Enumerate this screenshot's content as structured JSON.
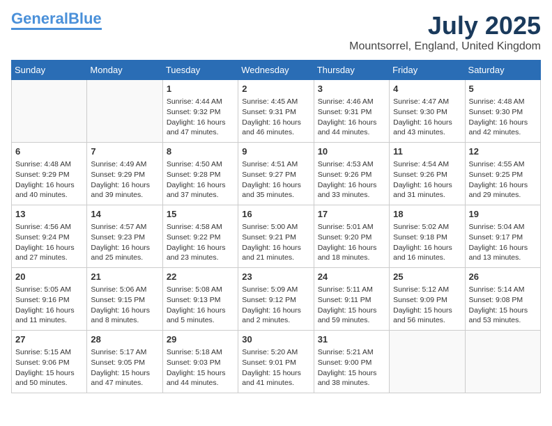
{
  "header": {
    "logo_general": "General",
    "logo_blue": "Blue",
    "month_year": "July 2025",
    "location": "Mountsorrel, England, United Kingdom"
  },
  "days_of_week": [
    "Sunday",
    "Monday",
    "Tuesday",
    "Wednesday",
    "Thursday",
    "Friday",
    "Saturday"
  ],
  "weeks": [
    [
      {
        "day": "",
        "info": ""
      },
      {
        "day": "",
        "info": ""
      },
      {
        "day": "1",
        "info": "Sunrise: 4:44 AM\nSunset: 9:32 PM\nDaylight: 16 hours\nand 47 minutes."
      },
      {
        "day": "2",
        "info": "Sunrise: 4:45 AM\nSunset: 9:31 PM\nDaylight: 16 hours\nand 46 minutes."
      },
      {
        "day": "3",
        "info": "Sunrise: 4:46 AM\nSunset: 9:31 PM\nDaylight: 16 hours\nand 44 minutes."
      },
      {
        "day": "4",
        "info": "Sunrise: 4:47 AM\nSunset: 9:30 PM\nDaylight: 16 hours\nand 43 minutes."
      },
      {
        "day": "5",
        "info": "Sunrise: 4:48 AM\nSunset: 9:30 PM\nDaylight: 16 hours\nand 42 minutes."
      }
    ],
    [
      {
        "day": "6",
        "info": "Sunrise: 4:48 AM\nSunset: 9:29 PM\nDaylight: 16 hours\nand 40 minutes."
      },
      {
        "day": "7",
        "info": "Sunrise: 4:49 AM\nSunset: 9:29 PM\nDaylight: 16 hours\nand 39 minutes."
      },
      {
        "day": "8",
        "info": "Sunrise: 4:50 AM\nSunset: 9:28 PM\nDaylight: 16 hours\nand 37 minutes."
      },
      {
        "day": "9",
        "info": "Sunrise: 4:51 AM\nSunset: 9:27 PM\nDaylight: 16 hours\nand 35 minutes."
      },
      {
        "day": "10",
        "info": "Sunrise: 4:53 AM\nSunset: 9:26 PM\nDaylight: 16 hours\nand 33 minutes."
      },
      {
        "day": "11",
        "info": "Sunrise: 4:54 AM\nSunset: 9:26 PM\nDaylight: 16 hours\nand 31 minutes."
      },
      {
        "day": "12",
        "info": "Sunrise: 4:55 AM\nSunset: 9:25 PM\nDaylight: 16 hours\nand 29 minutes."
      }
    ],
    [
      {
        "day": "13",
        "info": "Sunrise: 4:56 AM\nSunset: 9:24 PM\nDaylight: 16 hours\nand 27 minutes."
      },
      {
        "day": "14",
        "info": "Sunrise: 4:57 AM\nSunset: 9:23 PM\nDaylight: 16 hours\nand 25 minutes."
      },
      {
        "day": "15",
        "info": "Sunrise: 4:58 AM\nSunset: 9:22 PM\nDaylight: 16 hours\nand 23 minutes."
      },
      {
        "day": "16",
        "info": "Sunrise: 5:00 AM\nSunset: 9:21 PM\nDaylight: 16 hours\nand 21 minutes."
      },
      {
        "day": "17",
        "info": "Sunrise: 5:01 AM\nSunset: 9:20 PM\nDaylight: 16 hours\nand 18 minutes."
      },
      {
        "day": "18",
        "info": "Sunrise: 5:02 AM\nSunset: 9:18 PM\nDaylight: 16 hours\nand 16 minutes."
      },
      {
        "day": "19",
        "info": "Sunrise: 5:04 AM\nSunset: 9:17 PM\nDaylight: 16 hours\nand 13 minutes."
      }
    ],
    [
      {
        "day": "20",
        "info": "Sunrise: 5:05 AM\nSunset: 9:16 PM\nDaylight: 16 hours\nand 11 minutes."
      },
      {
        "day": "21",
        "info": "Sunrise: 5:06 AM\nSunset: 9:15 PM\nDaylight: 16 hours\nand 8 minutes."
      },
      {
        "day": "22",
        "info": "Sunrise: 5:08 AM\nSunset: 9:13 PM\nDaylight: 16 hours\nand 5 minutes."
      },
      {
        "day": "23",
        "info": "Sunrise: 5:09 AM\nSunset: 9:12 PM\nDaylight: 16 hours\nand 2 minutes."
      },
      {
        "day": "24",
        "info": "Sunrise: 5:11 AM\nSunset: 9:11 PM\nDaylight: 15 hours\nand 59 minutes."
      },
      {
        "day": "25",
        "info": "Sunrise: 5:12 AM\nSunset: 9:09 PM\nDaylight: 15 hours\nand 56 minutes."
      },
      {
        "day": "26",
        "info": "Sunrise: 5:14 AM\nSunset: 9:08 PM\nDaylight: 15 hours\nand 53 minutes."
      }
    ],
    [
      {
        "day": "27",
        "info": "Sunrise: 5:15 AM\nSunset: 9:06 PM\nDaylight: 15 hours\nand 50 minutes."
      },
      {
        "day": "28",
        "info": "Sunrise: 5:17 AM\nSunset: 9:05 PM\nDaylight: 15 hours\nand 47 minutes."
      },
      {
        "day": "29",
        "info": "Sunrise: 5:18 AM\nSunset: 9:03 PM\nDaylight: 15 hours\nand 44 minutes."
      },
      {
        "day": "30",
        "info": "Sunrise: 5:20 AM\nSunset: 9:01 PM\nDaylight: 15 hours\nand 41 minutes."
      },
      {
        "day": "31",
        "info": "Sunrise: 5:21 AM\nSunset: 9:00 PM\nDaylight: 15 hours\nand 38 minutes."
      },
      {
        "day": "",
        "info": ""
      },
      {
        "day": "",
        "info": ""
      }
    ]
  ]
}
